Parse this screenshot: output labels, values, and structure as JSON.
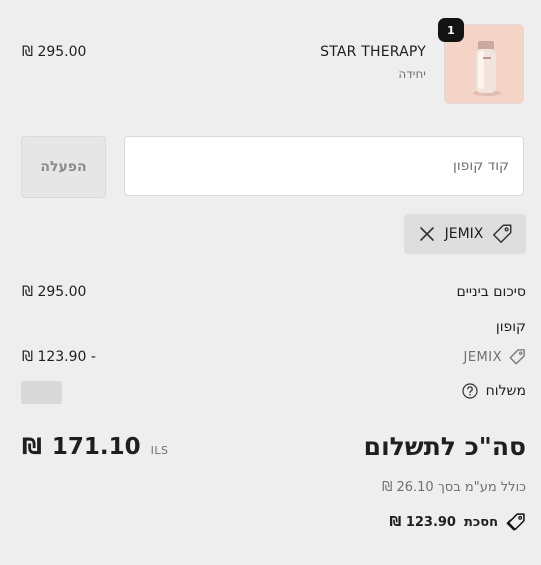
{
  "product": {
    "quantity": "1",
    "name": "STAR THERAPY",
    "variant": "יחידה",
    "price": "295.00 ₪"
  },
  "coupon": {
    "placeholder": "קוד קופון",
    "apply_label": "הפעלה",
    "applied_code": "JEMIX"
  },
  "summary": {
    "subtotal_label": "סיכום ביניים",
    "subtotal_value": "295.00 ₪",
    "coupon_label": "קופון",
    "coupon_code": "JEMIX",
    "coupon_discount": "- 123.90 ₪",
    "shipping_label": "משלוח"
  },
  "total": {
    "label": "סה\"כ לתשלום",
    "currency_code": "ILS",
    "amount": "171.10",
    "symbol": "₪",
    "vat_note": "כולל מע\"מ בסך 26.10 ₪",
    "savings_label": "חסכת",
    "savings_value": "123.90 ₪"
  },
  "colors": {
    "background": "#eeeeee",
    "text": "#1f1f1f",
    "muted": "#707070",
    "badge": "#141414",
    "product_bg": "#f4d4c7"
  },
  "icons": {
    "help": "question-circle",
    "tag": "tag",
    "remove": "x"
  }
}
